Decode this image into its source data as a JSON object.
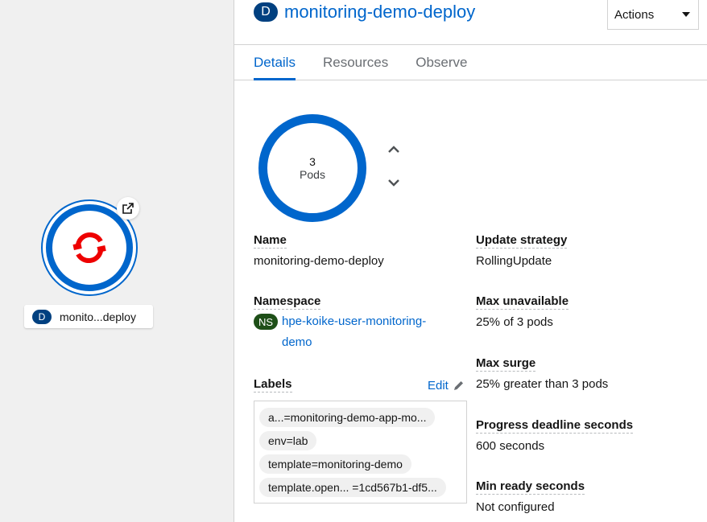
{
  "topology": {
    "node": {
      "badge": "D",
      "label": "monito...deploy"
    }
  },
  "panel": {
    "badge": "D",
    "title": "monitoring-demo-deploy",
    "actions_label": "Actions",
    "tabs": [
      {
        "label": "Details",
        "active": true
      },
      {
        "label": "Resources",
        "active": false
      },
      {
        "label": "Observe",
        "active": false
      }
    ],
    "pods": {
      "count": "3",
      "unit": "Pods"
    },
    "fields": {
      "name_label": "Name",
      "name_value": "monitoring-demo-deploy",
      "namespace_label": "Namespace",
      "namespace_badge": "NS",
      "namespace_value": "hpe-koike-user-monitoring-demo",
      "labels_label": "Labels",
      "edit_label": "Edit",
      "update_strategy_label": "Update strategy",
      "update_strategy_value": "RollingUpdate",
      "max_unavailable_label": "Max unavailable",
      "max_unavailable_value": "25% of 3 pods",
      "max_surge_label": "Max surge",
      "max_surge_value": "25% greater than 3 pods",
      "progress_deadline_label": "Progress deadline seconds",
      "progress_deadline_value": "600 seconds",
      "min_ready_label": "Min ready seconds",
      "min_ready_value": "Not configured"
    },
    "labels": [
      "a...=monitoring-demo-app-mo...",
      "env=lab",
      "template=monitoring-demo",
      "template.open...  =1cd567b1-df5..."
    ]
  },
  "colors": {
    "accent": "#0066cc",
    "badge_deployment": "#004080",
    "badge_namespace": "#1e4f18",
    "logo_red": "#e00"
  }
}
